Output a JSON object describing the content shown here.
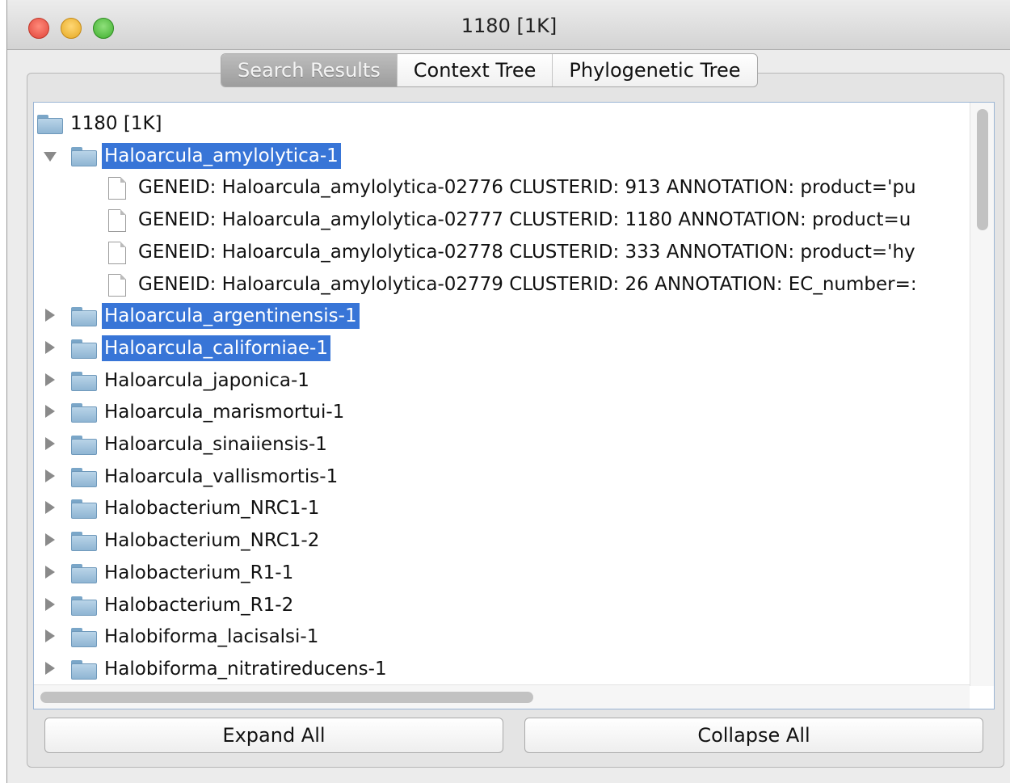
{
  "window": {
    "title": "1180 [1K]"
  },
  "tabs": [
    {
      "label": "Search Results",
      "active": true
    },
    {
      "label": "Context Tree",
      "active": false
    },
    {
      "label": "Phylogenetic Tree",
      "active": false
    }
  ],
  "tree": {
    "root": {
      "label": "1180 [1K]",
      "icon": "folder-icon"
    },
    "expanded_node": {
      "label": "Haloarcula_amylolytica-1",
      "selected": true,
      "children": [
        "GENEID: Haloarcula_amylolytica-02776 CLUSTERID: 913 ANNOTATION: product='pu",
        "GENEID: Haloarcula_amylolytica-02777 CLUSTERID: 1180 ANNOTATION: product=u",
        "GENEID: Haloarcula_amylolytica-02778 CLUSTERID: 333 ANNOTATION: product='hy",
        "GENEID: Haloarcula_amylolytica-02779 CLUSTERID: 26 ANNOTATION: EC_number=:"
      ]
    },
    "collapsed_nodes": [
      {
        "label": "Haloarcula_argentinensis-1",
        "selected": true
      },
      {
        "label": "Haloarcula_californiae-1",
        "selected": true
      },
      {
        "label": "Haloarcula_japonica-1",
        "selected": false
      },
      {
        "label": "Haloarcula_marismortui-1",
        "selected": false
      },
      {
        "label": "Haloarcula_sinaiiensis-1",
        "selected": false
      },
      {
        "label": "Haloarcula_vallismortis-1",
        "selected": false
      },
      {
        "label": "Halobacterium_NRC1-1",
        "selected": false
      },
      {
        "label": "Halobacterium_NRC1-2",
        "selected": false
      },
      {
        "label": "Halobacterium_R1-1",
        "selected": false
      },
      {
        "label": "Halobacterium_R1-2",
        "selected": false
      },
      {
        "label": "Halobiforma_lacisalsi-1",
        "selected": false
      },
      {
        "label": "Halobiforma_nitratireducens-1",
        "selected": false
      }
    ]
  },
  "buttons": {
    "expand_all": "Expand All",
    "collapse_all": "Collapse All"
  },
  "colors": {
    "selection": "#3875d7",
    "folder": "#a9c8e2"
  }
}
